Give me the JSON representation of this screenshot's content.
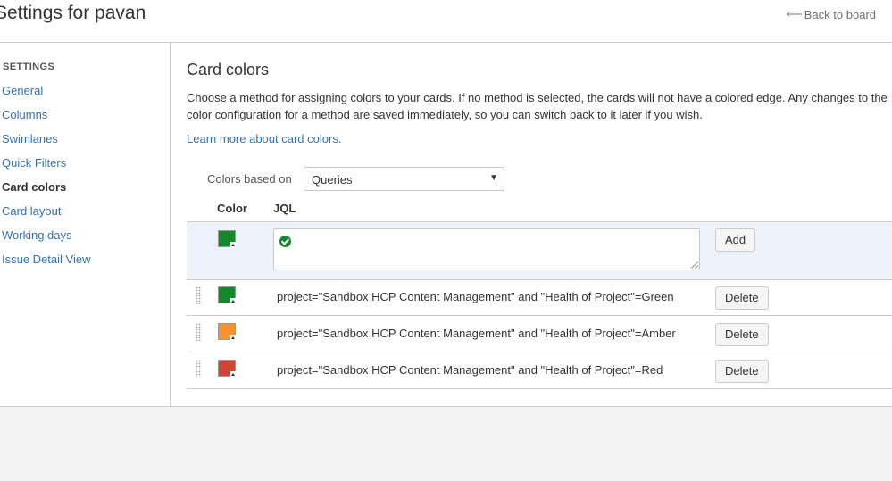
{
  "header": {
    "title": "Settings for pavan",
    "back_label": "Back to board"
  },
  "sidebar": {
    "heading": "SETTINGS",
    "items": [
      {
        "label": "General",
        "active": false
      },
      {
        "label": "Columns",
        "active": false
      },
      {
        "label": "Swimlanes",
        "active": false
      },
      {
        "label": "Quick Filters",
        "active": false
      },
      {
        "label": "Card colors",
        "active": true
      },
      {
        "label": "Card layout",
        "active": false
      },
      {
        "label": "Working days",
        "active": false
      },
      {
        "label": "Issue Detail View",
        "active": false
      }
    ]
  },
  "main": {
    "title": "Card colors",
    "description": "Choose a method for assigning colors to your cards. If no method is selected, the cards will not have a colored edge. Any changes to the color configuration for a method are saved immediately, so you can switch back to it later if you wish.",
    "learn_more": "Learn more about card colors.",
    "based_on_label": "Colors based on",
    "based_on_value": "Queries",
    "columns": {
      "color": "Color",
      "jql": "JQL"
    },
    "add_row": {
      "color": "#14892c",
      "jql_value": "",
      "add_label": "Add"
    },
    "rules": [
      {
        "color": "#14892c",
        "jql": "project=\"Sandbox HCP Content Management\" and \"Health of Project\"=Green",
        "delete_label": "Delete"
      },
      {
        "color": "#f79232",
        "jql": "project=\"Sandbox HCP Content Management\" and \"Health of Project\"=Amber",
        "delete_label": "Delete"
      },
      {
        "color": "#d04437",
        "jql": "project=\"Sandbox HCP Content Management\" and \"Health of Project\"=Red",
        "delete_label": "Delete"
      }
    ]
  },
  "colors": {
    "link": "#3572b0",
    "add_row_background": "#ebf2f9",
    "success": "#14892c"
  }
}
